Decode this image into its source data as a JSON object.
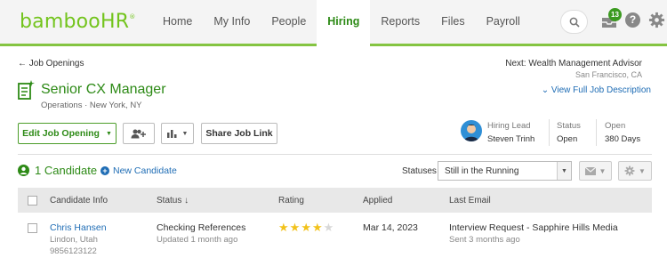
{
  "brand": {
    "logo_text": "bambooHR",
    "logo_mark": "®",
    "accent": "#73c41d"
  },
  "nav": {
    "items": [
      {
        "label": "Home"
      },
      {
        "label": "My Info"
      },
      {
        "label": "People"
      },
      {
        "label": "Hiring"
      },
      {
        "label": "Reports"
      },
      {
        "label": "Files"
      },
      {
        "label": "Payroll"
      }
    ],
    "active": "Hiring",
    "inbox_count": "13",
    "help_label": "?"
  },
  "header": {
    "back_link": "Job Openings",
    "next_label": "Next: Wealth Management Advisor",
    "next_location": "San Francisco, CA",
    "job_title": "Senior CX Manager",
    "job_subtitle": "Operations · New York, NY",
    "full_description_link": "View Full Job Description"
  },
  "actions": {
    "edit_label": "Edit Job Opening",
    "share_label": "Share Job Link"
  },
  "meta": {
    "hiring_lead_label": "Hiring Lead",
    "hiring_lead_value": "Steven Trinh",
    "status_label": "Status",
    "status_value": "Open",
    "open_label": "Open",
    "open_value": "380 Days"
  },
  "candidates": {
    "count_label": "1 Candidate",
    "new_label": "New Candidate",
    "statuses_label": "Statuses",
    "status_filter": "Still in the Running"
  },
  "table": {
    "columns": [
      "Candidate Info",
      "Status",
      "Rating",
      "Applied",
      "Last Email"
    ],
    "sort_indicator": "↓",
    "rows": [
      {
        "name": "Chris Hansen",
        "location": "Lindon, Utah",
        "phone": "9856123122",
        "status": "Checking References",
        "status_updated": "Updated 1 month ago",
        "rating": 4,
        "rating_max": 5,
        "applied": "Mar 14, 2023",
        "last_email": "Interview Request - Sapphire Hills Media",
        "last_email_sent": "Sent 3 months ago"
      }
    ]
  }
}
